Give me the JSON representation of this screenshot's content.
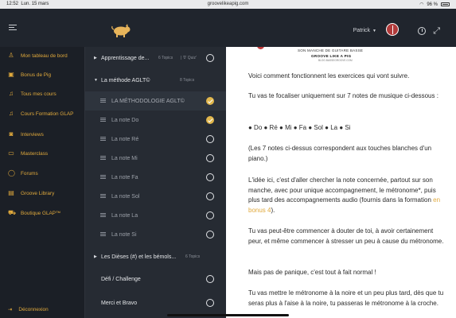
{
  "statusbar": {
    "time": "12:52",
    "date": "Lun. 15 mars",
    "url": "groovelikeapig.com",
    "battery": "96 %"
  },
  "header": {
    "user": "Patrick"
  },
  "sidebar": {
    "items": [
      {
        "label": "Mon tableau de bord",
        "icon": "user-icon"
      },
      {
        "label": "Bonus de Pig",
        "icon": "box-icon"
      },
      {
        "label": "Tous mes cours",
        "icon": "music-note-icon"
      },
      {
        "label": "Cours Formation GLAP",
        "icon": "music-note-icon"
      },
      {
        "label": "Interviews",
        "icon": "microphone-icon"
      },
      {
        "label": "Masterclass",
        "icon": "video-icon"
      },
      {
        "label": "Forums",
        "icon": "chat-icon"
      },
      {
        "label": "Groove Library",
        "icon": "book-icon"
      },
      {
        "label": "Boutique GLAP™",
        "icon": "cart-icon"
      }
    ],
    "logout": "Déconnexion"
  },
  "lessons": {
    "sections": [
      {
        "title": "Apprentissage de...",
        "topics": "6 Topics",
        "quiz": "| '0' Quiz'",
        "expanded": false
      },
      {
        "title": "La méthode AGLT©",
        "topics": "8 Topics",
        "expanded": true
      }
    ],
    "topics": [
      {
        "label": "LA MÉTHODOLOGIE AGLT©",
        "done": true,
        "active": true
      },
      {
        "label": "La note Do",
        "done": true
      },
      {
        "label": "La note Ré",
        "done": false
      },
      {
        "label": "La note Mi",
        "done": false
      },
      {
        "label": "La note Fa",
        "done": false
      },
      {
        "label": "La note Sol",
        "done": false
      },
      {
        "label": "La note La",
        "done": false
      },
      {
        "label": "La note Si",
        "done": false
      }
    ],
    "section3": {
      "title": "Les Dièses (#) et les bémols...",
      "topics": "6 Topics"
    },
    "extra": [
      "Défi / Challenge",
      "Merci et Bravo"
    ]
  },
  "content": {
    "banner": {
      "line1": "SON MANCHE DE GUITARE BASSE",
      "line2": "GROOVE LIKE A PIG",
      "line3": "BLOG.BASSEGROOVE.COM"
    },
    "p1": "Voici comment fonctionnent les exercices qui vont suivre.",
    "p2": "Tu vas te focaliser uniquement sur 7 notes de musique ci-dessous  :",
    "p3": "● Do ● Ré ● Mi ● Fa ● Sol ● La ● Si",
    "p4": "(Les 7 notes ci-dessus correspondent aux touches blanches d'un piano.)",
    "p5_a": "L'idée ici, c'est d'aller chercher la note concernée, partout sur son manche, avec pour unique accompagnement, le métronome*, puis plus tard des accompagnements audio (fournis dans la formation ",
    "p5_link": "en bonus 4",
    "p5_b": ").",
    "p6": "Tu vas peut-être commencer à douter de toi, à avoir certainement peur, et même commencer à stresser un peu à cause du métronome.",
    "p7": "Mais pas de panique, c'est tout à fait normal !",
    "p8": "Tu vas mettre le métronome à la noire et un peu plus tard, dès que tu seras plus à l'aise à la noire, tu passeras le métronome à la croche."
  },
  "colors": {
    "accent": "#e0a93c",
    "check": "#e0b64c",
    "sidebar_bg": "#1b1f26",
    "list_bg": "#262b33"
  }
}
